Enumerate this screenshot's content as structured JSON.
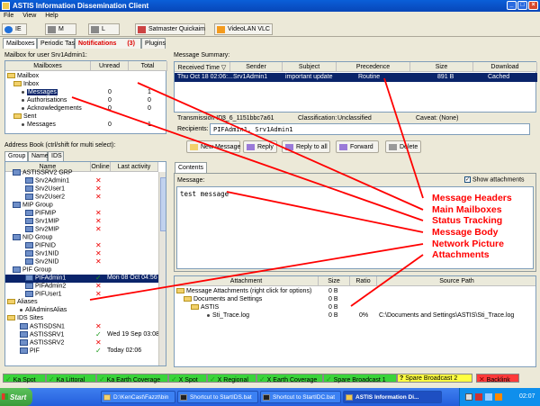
{
  "window": {
    "title": "ASTIS Information Dissemination Client"
  },
  "menu": [
    "File",
    "View",
    "Help"
  ],
  "toolbar": [
    {
      "label": "IE"
    },
    {
      "label": "M"
    },
    {
      "label": "L"
    },
    {
      "label": "Satmaster Quickaim"
    },
    {
      "label": "VideoLAN VLC"
    }
  ],
  "tabs": {
    "mailboxes": "Mailboxes",
    "periodic": "Periodic Tasks",
    "notifications": "Notifications",
    "notif_count": "(3)",
    "plugins": "Plugins"
  },
  "mailbox_panel": {
    "title": "Mailbox for user Srv1Admin1:",
    "columns": [
      "Mailboxes",
      "Unread",
      "Total"
    ],
    "rows": [
      {
        "name": "Mailbox",
        "unread": "",
        "total": ""
      },
      {
        "name": "Inbox",
        "unread": "",
        "total": ""
      },
      {
        "name": "Messages",
        "unread": "0",
        "total": "1"
      },
      {
        "name": "Authorisations",
        "unread": "0",
        "total": "0"
      },
      {
        "name": "Acknowledgements",
        "unread": "0",
        "total": "0"
      },
      {
        "name": "Sent",
        "unread": "",
        "total": ""
      },
      {
        "name": "Messages",
        "unread": "0",
        "total": "1"
      }
    ]
  },
  "address_book": {
    "title": "Address Book (ctrl/shift for multi select):",
    "tabs": [
      "Group",
      "Name",
      "IDS"
    ],
    "columns": [
      "Name",
      "Online",
      "Last activity"
    ],
    "rows": [
      {
        "name": "ASTISSRV2 GRP",
        "online": "",
        "last": "",
        "kind": "group"
      },
      {
        "name": "Srv2Admin1",
        "online": "x",
        "last": "",
        "kind": "user"
      },
      {
        "name": "Srv2User1",
        "online": "x",
        "last": "",
        "kind": "user"
      },
      {
        "name": "Srv2User2",
        "online": "x",
        "last": "",
        "kind": "user"
      },
      {
        "name": "MIP Group",
        "online": "",
        "last": "",
        "kind": "group"
      },
      {
        "name": "PIFMIP",
        "online": "x",
        "last": "",
        "kind": "user"
      },
      {
        "name": "Srv1MIP",
        "online": "x",
        "last": "",
        "kind": "user"
      },
      {
        "name": "Srv2MIP",
        "online": "x",
        "last": "",
        "kind": "user"
      },
      {
        "name": "NID Group",
        "online": "",
        "last": "",
        "kind": "group"
      },
      {
        "name": "PIFNID",
        "online": "x",
        "last": "",
        "kind": "user"
      },
      {
        "name": "Srv1NID",
        "online": "x",
        "last": "",
        "kind": "user"
      },
      {
        "name": "Srv2NID",
        "online": "x",
        "last": "",
        "kind": "user"
      },
      {
        "name": "PIF Group",
        "online": "",
        "last": "",
        "kind": "group"
      },
      {
        "name": "PIFAdmin1",
        "online": "v",
        "last": "Mon 08 Oct 04:56",
        "kind": "user",
        "selected": true
      },
      {
        "name": "PIFAdmin2",
        "online": "x",
        "last": "",
        "kind": "user"
      },
      {
        "name": "PIFUser1",
        "online": "x",
        "last": "",
        "kind": "user"
      },
      {
        "name": "Aliases",
        "online": "",
        "last": "",
        "kind": "folder"
      },
      {
        "name": "AllAdminsAlias",
        "online": "",
        "last": "",
        "kind": "alias"
      },
      {
        "name": "IDS Sites",
        "online": "",
        "last": "",
        "kind": "folder"
      },
      {
        "name": "ASTISDSN1",
        "online": "x",
        "last": "",
        "kind": "site"
      },
      {
        "name": "ASTISSRV1",
        "online": "v",
        "last": "Wed 19 Sep 03:08",
        "kind": "site"
      },
      {
        "name": "ASTISSRV2",
        "online": "x",
        "last": "",
        "kind": "site"
      },
      {
        "name": "PIF",
        "online": "v",
        "last": "Today 02:06",
        "kind": "site"
      }
    ]
  },
  "summary": {
    "title": "Message Summary:",
    "columns": [
      "Received Time",
      "Sender",
      "Subject",
      "Precedence",
      "Size",
      "Download"
    ],
    "rows": [
      {
        "time": "Thu Oct 18 02:06:...",
        "sender": "Srv1Admin1",
        "subject": "important update",
        "precedence": "Routine",
        "size": "891 B",
        "download": "Cached"
      }
    ]
  },
  "details": {
    "transmission_label": "Transmission ID:",
    "transmission_id": "3_6_1151bbc7a61",
    "classification_label": "Classification:",
    "classification": "Unclassified",
    "caveat_label": "Caveat:",
    "caveat": "(None)",
    "recipients_label": "Recipients:",
    "recipients": "PIFAdmin1, Srv1Admin1"
  },
  "actions": [
    "New Message",
    "Reply",
    "Reply to all",
    "Forward",
    "Delete"
  ],
  "contents": {
    "tab": "Contents",
    "message_label": "Message:",
    "show_attachments": "Show attachments",
    "body": "test message"
  },
  "attachments": {
    "columns": [
      "Attachment",
      "Size",
      "Ratio",
      "Source Path"
    ],
    "rows": [
      {
        "name": "Message Attachments (right click for options)",
        "size": "0 B",
        "ratio": "",
        "path": ""
      },
      {
        "name": "Documents and Settings",
        "size": "0 B",
        "ratio": "",
        "path": ""
      },
      {
        "name": "ASTIS",
        "size": "0 B",
        "ratio": "",
        "path": ""
      },
      {
        "name": "Sti_Trace.log",
        "size": "0 B",
        "ratio": "0%",
        "path": "C:\\Documents and Settings\\ASTIS\\Sti_Trace.log"
      }
    ]
  },
  "status_strip": [
    {
      "label": "Ka Spot",
      "color": "green"
    },
    {
      "label": "Ka Littoral",
      "color": "green"
    },
    {
      "label": "Ka Earth Coverage",
      "color": "green"
    },
    {
      "label": "X Spot",
      "color": "green"
    },
    {
      "label": "X Regional",
      "color": "green"
    },
    {
      "label": "X Earth Coverage",
      "color": "green"
    },
    {
      "label": "Spare Broadcast 1",
      "color": "green"
    },
    {
      "label": "Spare Broadcast 2",
      "color": "yellow"
    },
    {
      "label": "Backlink",
      "color": "red"
    }
  ],
  "taskbar": {
    "start": "Start",
    "tasks": [
      "D:\\KenCast\\Fazzt\\bin",
      "Shortcut to StartIDS.bat",
      "Shortcut to StartIDC.bat",
      "ASTIS Information Di..."
    ],
    "clock": "02:07"
  },
  "annotations": [
    "Message Headers",
    "Main Mailboxes",
    "Status Tracking",
    "Message Body",
    "Network Picture",
    "Attachments"
  ],
  "colors": {
    "selection": "#0a246a",
    "annotation": "#ff0000",
    "titlebar": "#0a5fd8"
  }
}
